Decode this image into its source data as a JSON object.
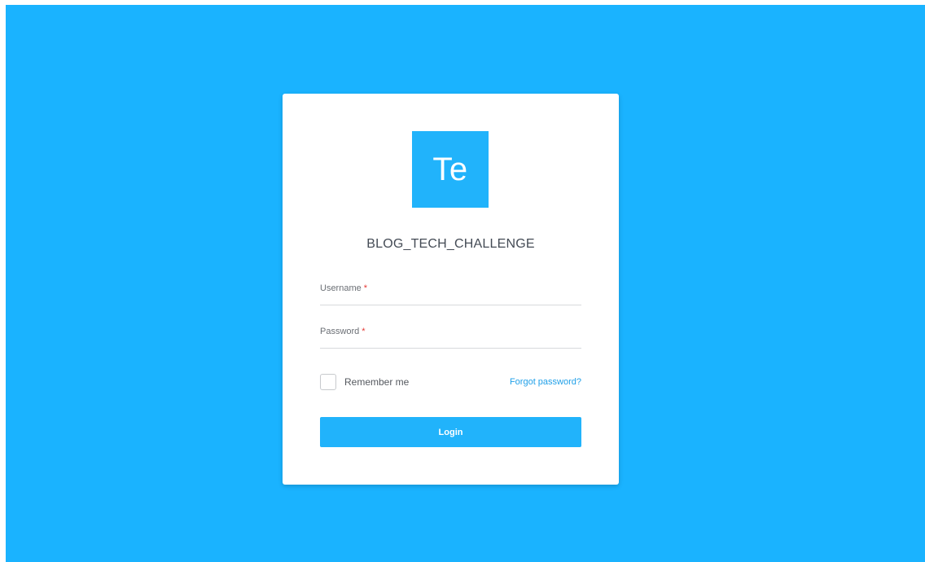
{
  "app": {
    "logo_text": "Te",
    "title": "BLOG_TECH_CHALLENGE"
  },
  "form": {
    "username": {
      "label": "Username",
      "required_mark": "*",
      "value": ""
    },
    "password": {
      "label": "Password",
      "required_mark": "*",
      "value": ""
    },
    "remember_me": {
      "label": "Remember me",
      "checked": false
    },
    "forgot_password_label": "Forgot password?",
    "login_label": "Login"
  },
  "colors": {
    "background": "#1ab3ff",
    "accent": "#21b3fb",
    "link": "#1e9fe8",
    "required": "#e53935"
  }
}
